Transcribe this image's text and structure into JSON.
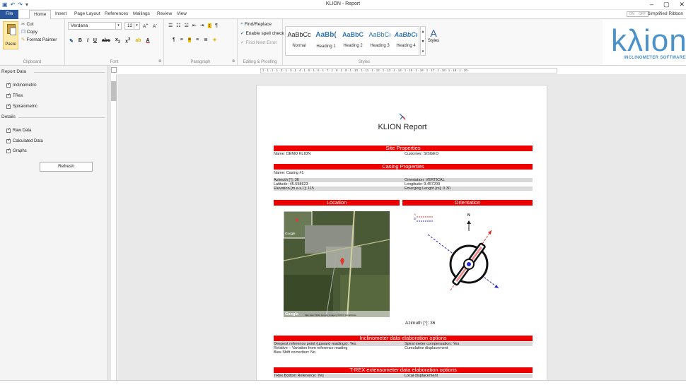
{
  "titlebar": {
    "title": "KLION - Report",
    "min": "–",
    "max": "▢",
    "close": "✕"
  },
  "tabs": [
    {
      "label": "File"
    },
    {
      "label": "Home"
    },
    {
      "label": "Insert"
    },
    {
      "label": "Page Layout"
    },
    {
      "label": "References"
    },
    {
      "label": "Mailings"
    },
    {
      "label": "Review"
    },
    {
      "label": "View"
    }
  ],
  "toggle": {
    "on": "ON",
    "off": "OFF"
  },
  "simplified_ribbon": "Simplified Ribbon",
  "ribbon": {
    "clipboard": {
      "paste": "Paste",
      "cut": "Cut",
      "copy": "Copy",
      "format_painter": "Format Painter",
      "label": "Clipboard"
    },
    "font": {
      "name": "Verdana",
      "size": "12",
      "label": "Font"
    },
    "paragraph": {
      "label": "Paragraph"
    },
    "editing": {
      "find_replace": "Find/Replace",
      "spell_check": "Enable spell check",
      "next_error": "Find Next Error",
      "label": "Editing & Proofing"
    },
    "styles": {
      "items": [
        {
          "sample": "AaBbCc",
          "name": "Normal"
        },
        {
          "sample": "AaBb(",
          "name": "Heading 1"
        },
        {
          "sample": "AaBbC",
          "name": "Heading 2"
        },
        {
          "sample": "AaBbCı",
          "name": "Heading 3"
        },
        {
          "sample": "AaBbCı",
          "name": "Heading 4"
        }
      ],
      "styles_button": "Styles",
      "label": "Styles"
    }
  },
  "logo": {
    "word": "kλion",
    "sub": "INCLINOMETER SOFTWARE"
  },
  "left_panel": {
    "report_data": {
      "title": "Report Data",
      "items": [
        "Inclinometric",
        "TRex",
        "Spiralometric"
      ]
    },
    "details": {
      "title": "Details",
      "items": [
        "Raw Data",
        "Calculated Data",
        "Graphs"
      ]
    },
    "refresh": "Refresh"
  },
  "ruler": "1 · 1 · 1 · 1 · 2 · 1 · 3 · 1 · 4 · 1 · 5 · 1 · 6 · 1 · 7 · 1 · 8 · 1 · 9 · 1 · 10 · 1 · 11 · 1 · 12 · 1 · 13 · 1 · 14 · 1 · 15 · 1 · 16 · 1 · 17 · 1 · 18 · 1 · 19 · 1 · 20 ·",
  "report": {
    "title": "KLION Report",
    "site": {
      "header": "Site Properties",
      "name": "Name: DEMO KLION",
      "customer": "Customer: SISGEO"
    },
    "casing": {
      "header": "Casing Properties",
      "name": "Name: Casing #1",
      "azimuth": "Azimuth [°]: 36",
      "orientation": "Orientation: VERTICAL",
      "latitude": "Latitude: 45.558623",
      "longitude": "Longitude: 9.457209",
      "elevation": "Elevation [m.a.s.l.]: 115",
      "emerging": "Emerging Lenght [m]: 0.30"
    },
    "location_header": "Location",
    "orientation_header": "Orientation",
    "legend_a": "A",
    "legend_b": "B",
    "north": "N",
    "azimuth_caption": "Azimuth [°]: 36",
    "map_google": "Google",
    "map_credit": "Map data ©2016 Google, Imagery ©2016, DigitalGlobe",
    "inclinometer": {
      "header": "Inclinometer data elaboration options",
      "deepest": "Deepest reference point (upward readings): Yes",
      "spiral": "Spiral meter compensation: Yes",
      "relative": "Relative – Variation from reference reading",
      "cumulative": "Cumulative displacement",
      "bias": "Bias Shift correction: No"
    },
    "trex": {
      "header": "T-REX extensometer data elaboration options",
      "bottom": "TRex Bottom Reference: Yes",
      "local": "Local displacement"
    }
  }
}
